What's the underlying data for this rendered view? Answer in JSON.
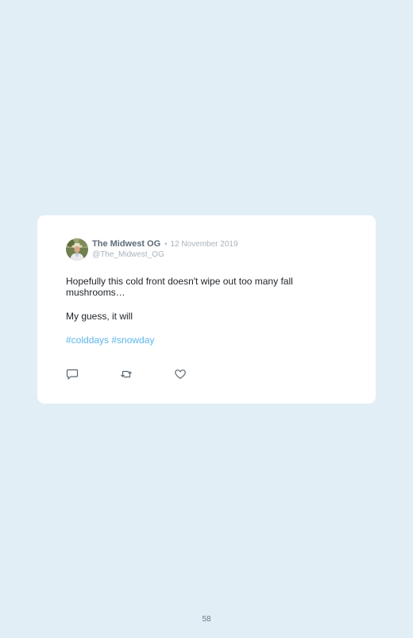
{
  "tweet": {
    "author_name": "The Midwest OG",
    "separator": "•",
    "date": "12 November 2019",
    "handle": "@The_Midwest_OG",
    "paragraphs": [
      "Hopefully this cold front doesn't wipe out too many fall mushrooms…",
      "My guess, it will"
    ],
    "hashtags": "#colddays #snowday",
    "icons": {
      "reply": "reply-icon",
      "retweet": "retweet-icon",
      "like": "heart-icon"
    }
  },
  "page": {
    "number": "58"
  },
  "colors": {
    "background": "#e1eef6",
    "card": "#ffffff",
    "name": "#5c6b79",
    "muted": "#a8b3bd",
    "hashtag": "#5bb6ea"
  }
}
